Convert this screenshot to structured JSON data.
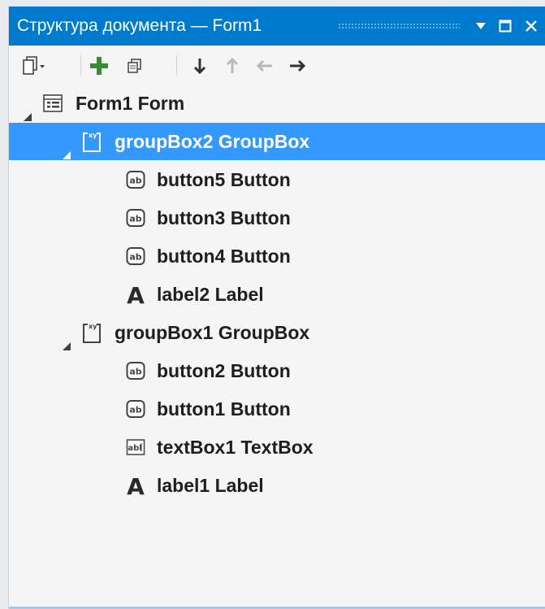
{
  "window": {
    "title": "Структура документа — Form1",
    "accent": "#007acc",
    "selection": "#3399ff"
  },
  "titlebar_buttons": [
    {
      "name": "dropdown",
      "icon": "triangle-down-icon"
    },
    {
      "name": "maximize",
      "icon": "square-icon"
    },
    {
      "name": "close",
      "icon": "close-icon"
    }
  ],
  "toolbar": [
    {
      "name": "document-view",
      "icon": "pages-dropdown-icon"
    },
    {
      "name": "add",
      "icon": "plus-icon"
    },
    {
      "name": "copy",
      "icon": "copy-icon"
    },
    {
      "name": "move-down",
      "icon": "arrow-down-icon",
      "enabled": true
    },
    {
      "name": "move-up",
      "icon": "arrow-up-icon",
      "enabled": false
    },
    {
      "name": "move-left",
      "icon": "arrow-left-icon",
      "enabled": false
    },
    {
      "name": "move-right",
      "icon": "arrow-right-icon",
      "enabled": true
    }
  ],
  "tree": [
    {
      "label": "Form1  Form",
      "icon": "form-icon",
      "level": 0,
      "expanded": true,
      "selected": false
    },
    {
      "label": "groupBox2  GroupBox",
      "icon": "groupbox-icon",
      "level": 1,
      "expanded": true,
      "selected": true
    },
    {
      "label": "button5  Button",
      "icon": "button-icon",
      "level": 2,
      "selected": false
    },
    {
      "label": "button3  Button",
      "icon": "button-icon",
      "level": 2,
      "selected": false
    },
    {
      "label": "button4  Button",
      "icon": "button-icon",
      "level": 2,
      "selected": false
    },
    {
      "label": "label2  Label",
      "icon": "label-icon",
      "level": 2,
      "selected": false
    },
    {
      "label": "groupBox1  GroupBox",
      "icon": "groupbox-icon",
      "level": 1,
      "expanded": true,
      "selected": false
    },
    {
      "label": "button2  Button",
      "icon": "button-icon",
      "level": 2,
      "selected": false
    },
    {
      "label": "button1  Button",
      "icon": "button-icon",
      "level": 2,
      "selected": false
    },
    {
      "label": "textBox1  TextBox",
      "icon": "textbox-icon",
      "level": 2,
      "selected": false
    },
    {
      "label": "label1  Label",
      "icon": "label-icon",
      "level": 2,
      "selected": false
    }
  ]
}
